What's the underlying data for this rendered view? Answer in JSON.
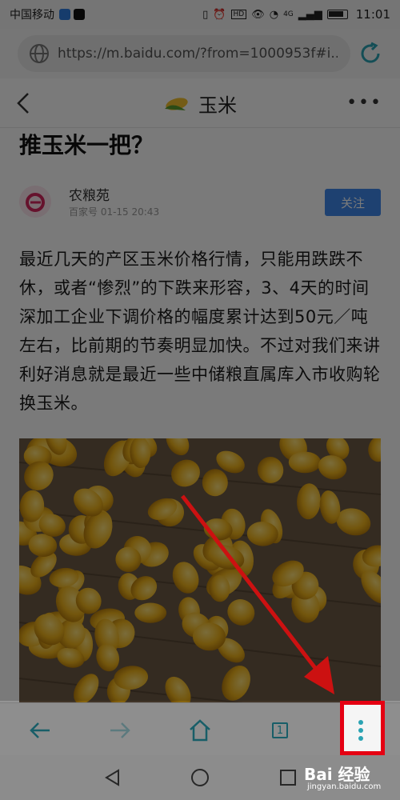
{
  "status_bar": {
    "carrier": "中国移动",
    "network": "4G",
    "time": "11:01"
  },
  "url_bar": {
    "url": "https://m.baidu.com/?from=1000953f#i..."
  },
  "title_bar": {
    "title": "玉米"
  },
  "article": {
    "headline": "推玉米一把？",
    "author": {
      "name": "农粮苑",
      "meta": "百家号   01-15 20:43",
      "follow_label": "关注"
    },
    "body": "最近几天的产区玉米价格行情，只能用跌跌不休，或者“惨烈”的下跌来形容，3、4天的时间深加工企业下调价格的幅度累计达到50元／吨左右，比前期的节奏明显加快。不过对我们来讲利好消息就是最近一些中储粮直属库入市收购轮换玉米。"
  },
  "toolbar": {
    "tab_count": "1",
    "accent": "#2aa3b3"
  },
  "annotation": {
    "highlight_color": "#e50012"
  },
  "watermark": {
    "text": "Bai 经验",
    "sub": "jingyan.baidu.com"
  }
}
